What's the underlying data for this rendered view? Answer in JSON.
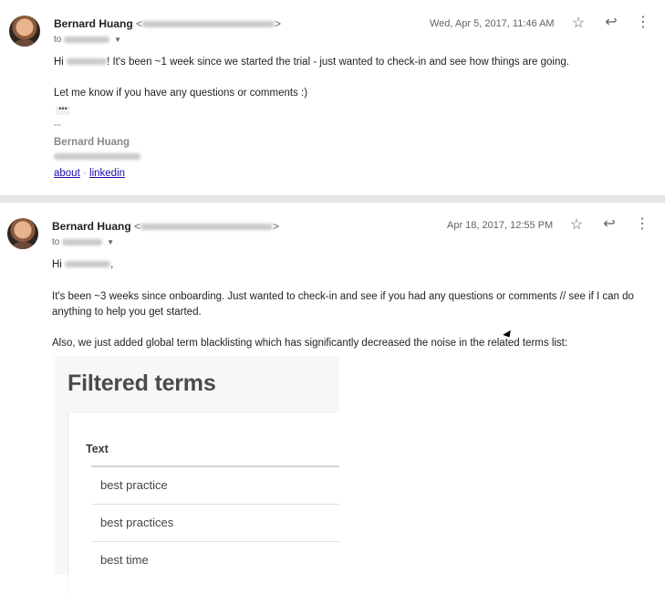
{
  "emails": [
    {
      "sender_name": "Bernard Huang",
      "addr_open": "<",
      "addr_close": ">",
      "to_label": "to",
      "date": "Wed, Apr 5, 2017, 11:46 AM",
      "lines": [
        "It's been ~1 week since we started the trial - just wanted to check-in and see how things are going.",
        "Let me know if you have any questions or comments :)"
      ],
      "greeting": "Hi",
      "expand_dots": "•••",
      "sig_dashes": "--",
      "sig_name": "Bernard Huang",
      "links": {
        "about": "about",
        "separator": " · ",
        "linkedin": "linkedin"
      }
    },
    {
      "sender_name": "Bernard Huang",
      "addr_open": "<",
      "addr_close": ">",
      "to_label": "to",
      "date": "Apr 18, 2017, 12:55 PM",
      "greeting": "Hi",
      "greeting_suffix": ",",
      "lines": [
        "It's been ~3 weeks since onboarding. Just wanted to check-in and see if you had any questions or comments // see if I can do",
        "anything to help you get started.",
        "Also, we just added global term blacklisting which has significantly decreased the noise in the related terms list:"
      ]
    }
  ],
  "icons": {
    "star": "star-icon",
    "reply": "reply-icon",
    "more": "more-vertical-icon"
  },
  "screenshot": {
    "title": "Filtered terms",
    "column_header": "Text",
    "rows": [
      "best practice",
      "best practices",
      "best time"
    ]
  }
}
